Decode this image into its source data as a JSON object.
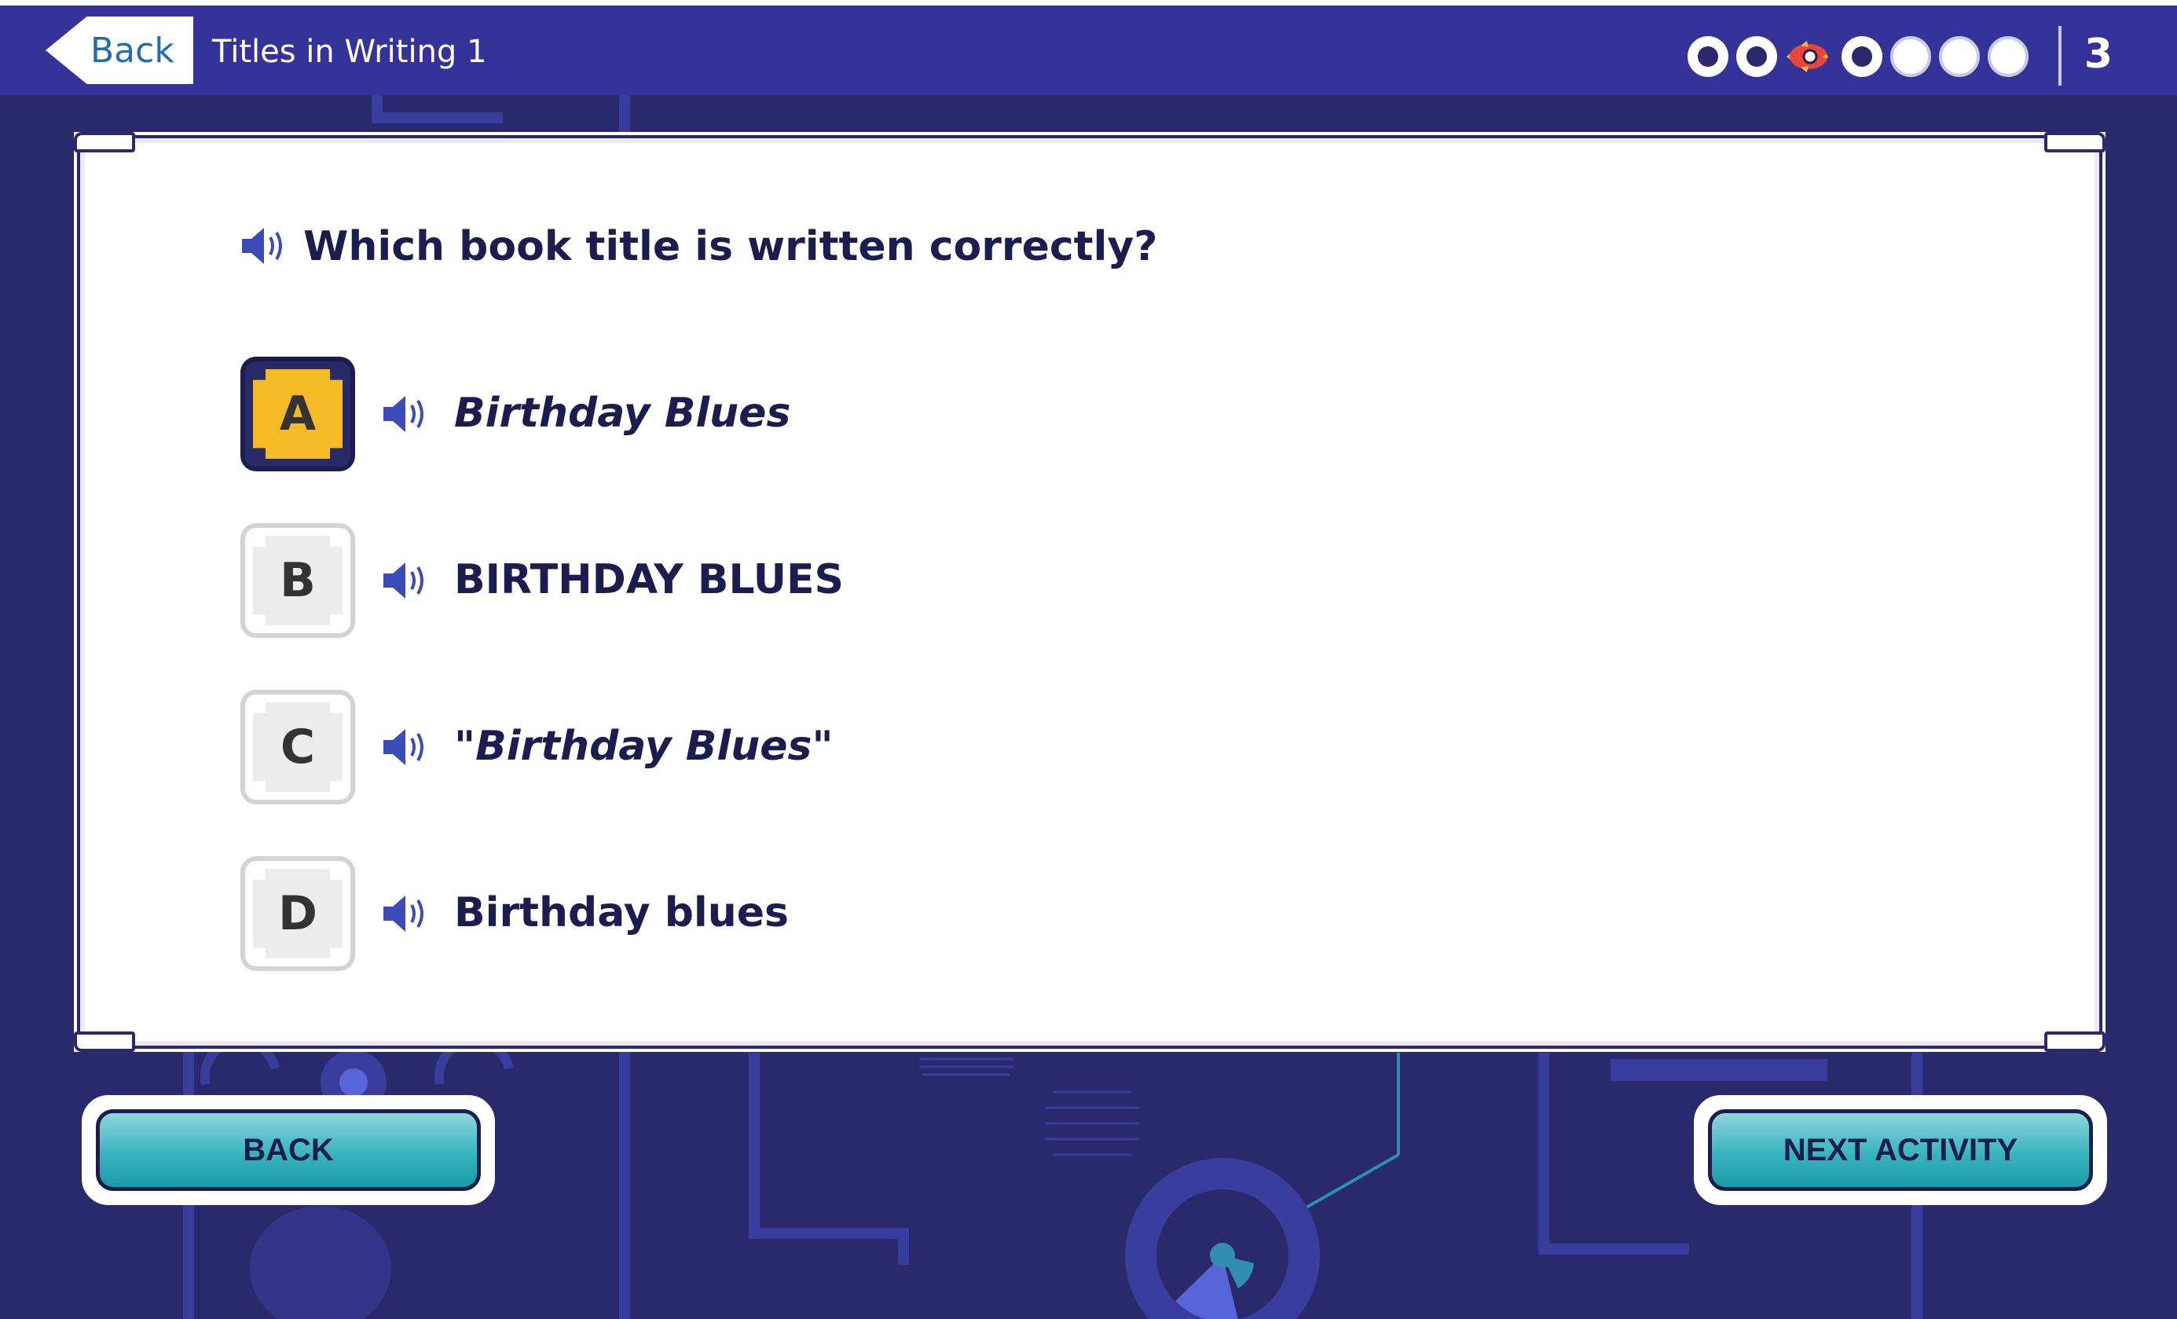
{
  "header": {
    "back_label": "Back",
    "title": "Titles in Writing 1",
    "score": "3",
    "progress": {
      "total": 7,
      "completed": 2,
      "current_index": 3,
      "current_icon": "rocket-icon"
    }
  },
  "question": {
    "prompt": "Which book title is written correctly?",
    "options": [
      {
        "letter": "A",
        "text": "Birthday Blues",
        "style": "italic",
        "selected": true
      },
      {
        "letter": "B",
        "text": "BIRTHDAY BLUES",
        "style": "normal",
        "selected": false
      },
      {
        "letter": "C",
        "text": "\"Birthday Blues\"",
        "style": "italic",
        "selected": false
      },
      {
        "letter": "D",
        "text": "Birthday blues",
        "style": "normal",
        "selected": false
      }
    ]
  },
  "footer": {
    "back_button": "BACK",
    "next_button": "NEXT ACTIVITY"
  },
  "colors": {
    "header_bg": "#353399",
    "page_bg": "#29296b",
    "text_dark": "#1c1d4f",
    "selected_accent": "#f4bb25",
    "button_teal": "#38b5bf",
    "link_blue": "#226cae"
  }
}
